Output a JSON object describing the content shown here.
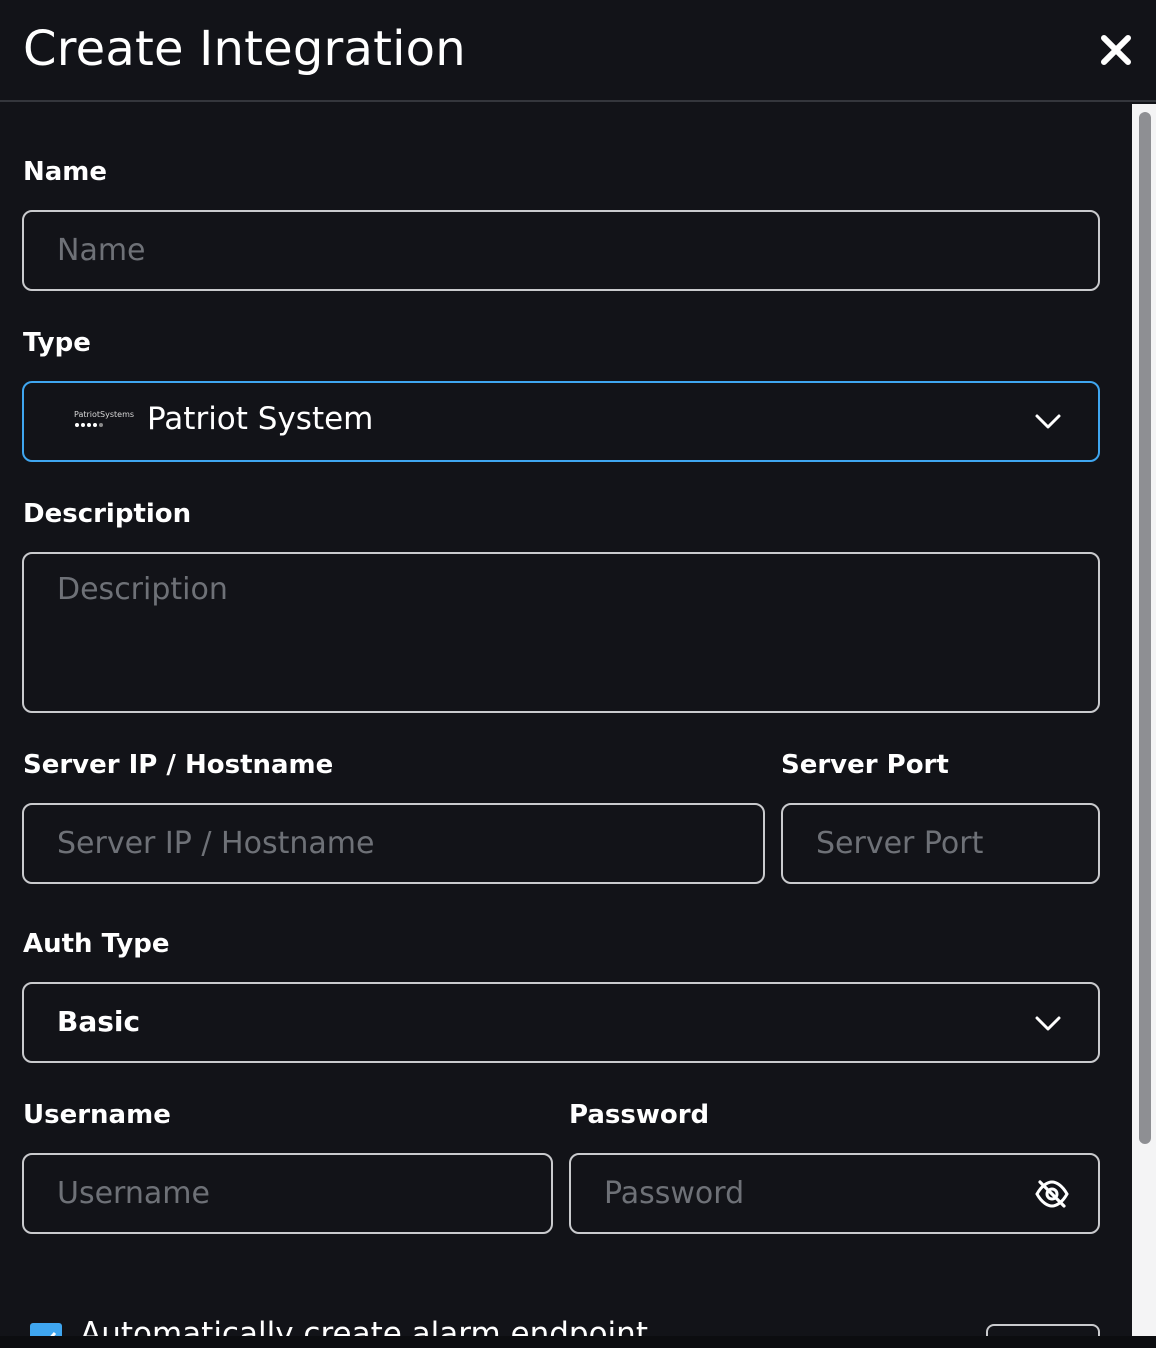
{
  "dialog": {
    "title": "Create Integration",
    "close_icon": "close-icon"
  },
  "form": {
    "name": {
      "label": "Name",
      "placeholder": "Name",
      "value": ""
    },
    "type": {
      "label": "Type",
      "value": "Patriot System",
      "logo_text": "PatriotSystems",
      "icon": "chevron-down-icon"
    },
    "description": {
      "label": "Description",
      "placeholder": "Description",
      "value": ""
    },
    "server_host": {
      "label": "Server IP / Hostname",
      "placeholder": "Server IP / Hostname",
      "value": ""
    },
    "server_port": {
      "label": "Server Port",
      "placeholder": "Server Port",
      "value": ""
    },
    "auth_type": {
      "label": "Auth Type",
      "value": "Basic",
      "icon": "chevron-down-icon"
    },
    "username": {
      "label": "Username",
      "placeholder": "Username",
      "value": ""
    },
    "password": {
      "label": "Password",
      "placeholder": "Password",
      "value": "",
      "icon": "eye-off-icon"
    },
    "auto_endpoint": {
      "label": "Automatically create alarm endpoint",
      "checked": true
    }
  },
  "colors": {
    "background": "#121318",
    "accent": "#3fa6f0",
    "border": "#c9cacd",
    "placeholder": "#6e7177"
  }
}
